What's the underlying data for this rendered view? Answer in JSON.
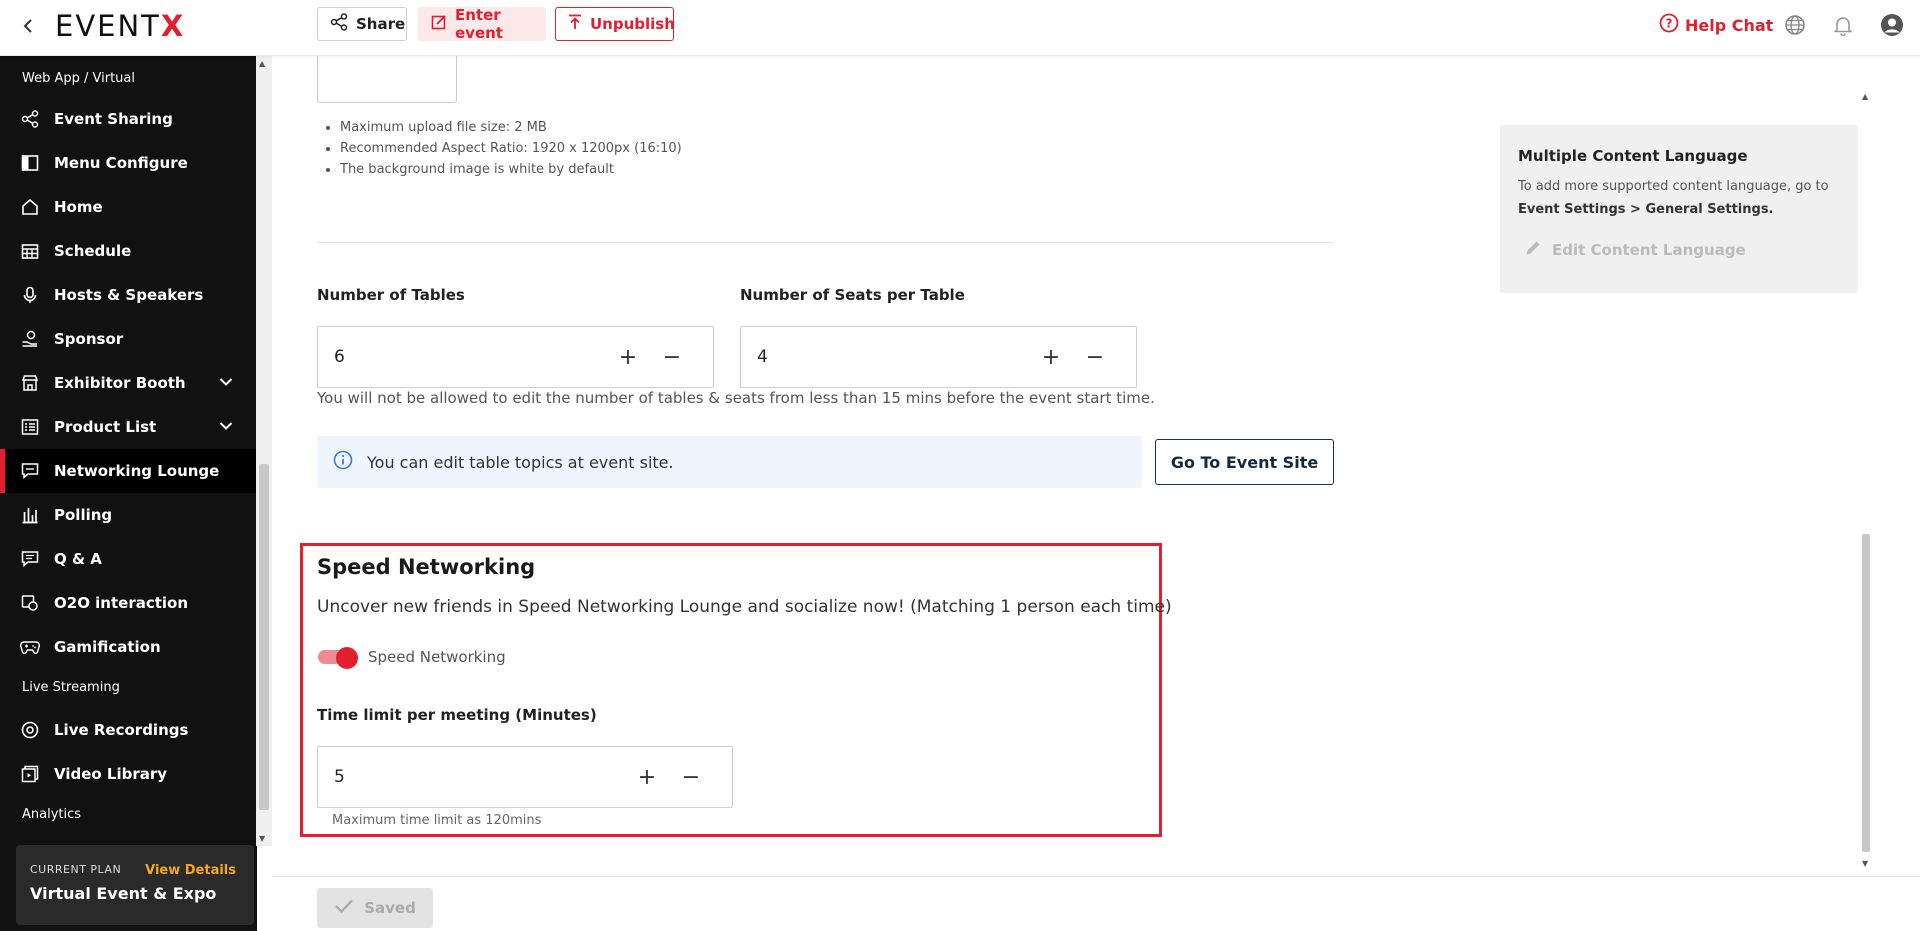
{
  "header": {
    "logo_text": "EVENT",
    "logo_x": "X",
    "share_label": "Share",
    "enter_event_label": "Enter event",
    "unpublish_label": "Unpublish",
    "help_chat_label": "Help Chat"
  },
  "sidebar": {
    "section_web_app": "Web App / Virtual",
    "items": [
      {
        "label": "Event Sharing",
        "icon": "share-icon"
      },
      {
        "label": "Menu Configure",
        "icon": "layout-icon"
      },
      {
        "label": "Home",
        "icon": "home-icon"
      },
      {
        "label": "Schedule",
        "icon": "calendar-icon"
      },
      {
        "label": "Hosts & Speakers",
        "icon": "microphone-icon"
      },
      {
        "label": "Sponsor",
        "icon": "hand-coin-icon"
      },
      {
        "label": "Exhibitor Booth",
        "icon": "store-icon"
      },
      {
        "label": "Product List",
        "icon": "list-icon"
      },
      {
        "label": "Networking Lounge",
        "icon": "chat-icon"
      },
      {
        "label": "Polling",
        "icon": "bar-chart-icon"
      },
      {
        "label": "Q & A",
        "icon": "qa-icon"
      },
      {
        "label": "O2O interaction",
        "icon": "o2o-icon"
      },
      {
        "label": "Gamification",
        "icon": "gamepad-icon"
      }
    ],
    "section_live": "Live Streaming",
    "live_items": [
      {
        "label": "Live Recordings",
        "icon": "record-icon"
      },
      {
        "label": "Video Library",
        "icon": "video-library-icon"
      }
    ],
    "section_analytics": "Analytics",
    "plan": {
      "title": "CURRENT PLAN",
      "view_details": "View Details",
      "name": "Virtual Event & Expo"
    }
  },
  "upload_info": {
    "bullets": [
      "Maximum upload file size: 2 MB",
      "Recommended Aspect Ratio: 1920 x 1200px (16:10)",
      "The background image is white by default"
    ]
  },
  "tables": {
    "tables_label": "Number of Tables",
    "tables_value": "6",
    "seats_label": "Number of Seats per Table",
    "seats_value": "4",
    "hint": "You will not be allowed to edit the number of tables & seats from less than 15 mins before the event start time.",
    "info_text": "You can edit table topics at event site.",
    "goto_label": "Go To Event Site"
  },
  "speed": {
    "title": "Speed Networking",
    "description": "Uncover new friends in Speed Networking Lounge and socialize now! (Matching 1 person each time)",
    "toggle_label": "Speed Networking",
    "toggle_on": true,
    "time_label": "Time limit per meeting (Minutes)",
    "time_value": "5",
    "time_hint": "Maximum time limit as 120mins"
  },
  "language_panel": {
    "title": "Multiple Content Language",
    "text_prefix": "To add more supported content language, go to",
    "text_link": "Event Settings > General Settings.",
    "edit_label": "Edit Content Language"
  },
  "footer": {
    "saved_label": "Saved"
  },
  "colors": {
    "brand_red": "#e0202e",
    "sidebar_bg": "#111111",
    "info_bg": "#eef5ff",
    "plan_accent": "#f5a623"
  }
}
